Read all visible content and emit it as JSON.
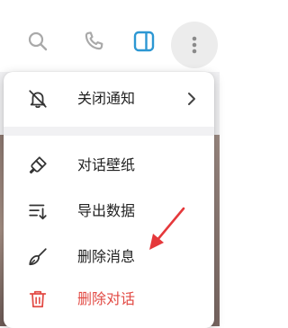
{
  "toolbar": {
    "icons": [
      "search-icon",
      "phone-icon",
      "side-panel-icon",
      "more-vertical-icon"
    ],
    "accent": "#2c97d3"
  },
  "menu": {
    "items": [
      {
        "label": "关闭通知",
        "icon": "bell-off-icon",
        "has_submenu": true
      },
      {
        "label": "对话壁纸",
        "icon": "brush-icon",
        "has_submenu": false
      },
      {
        "label": "导出数据",
        "icon": "export-list-icon",
        "has_submenu": false
      },
      {
        "label": "删除消息",
        "icon": "broom-icon",
        "has_submenu": false
      },
      {
        "label": "删除对话",
        "icon": "trash-icon",
        "has_submenu": false,
        "danger": true
      }
    ],
    "danger_color": "#e24a44",
    "annotation_color": "#e5383b"
  }
}
